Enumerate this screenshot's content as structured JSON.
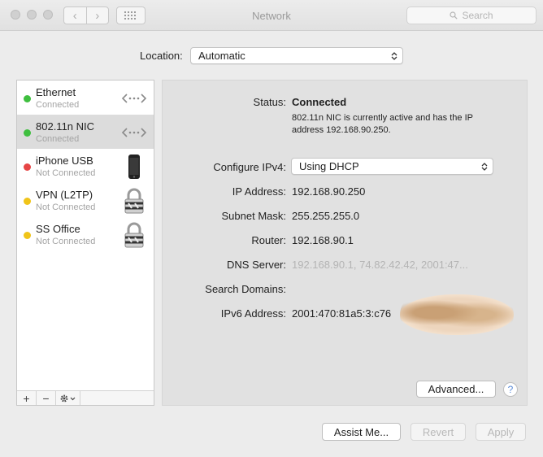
{
  "window": {
    "title": "Network"
  },
  "search": {
    "placeholder": "Search"
  },
  "location": {
    "label": "Location:",
    "value": "Automatic"
  },
  "services": [
    {
      "name": "Ethernet",
      "status": "Connected",
      "dot_color": "#3fbf3f",
      "icon": "ethernet-arrows-icon"
    },
    {
      "name": "802.11n NIC",
      "status": "Connected",
      "dot_color": "#3fbf3f",
      "icon": "ethernet-arrows-icon",
      "selected": true
    },
    {
      "name": "iPhone USB",
      "status": "Not Connected",
      "dot_color": "#e64545",
      "icon": "iphone-icon"
    },
    {
      "name": "VPN (L2TP)",
      "status": "Not Connected",
      "dot_color": "#f0c419",
      "icon": "lock-icon"
    },
    {
      "name": "SS Office",
      "status": "Not Connected",
      "dot_color": "#f0c419",
      "icon": "lock-icon"
    }
  ],
  "toolbar": {
    "add": "+",
    "remove": "−"
  },
  "detail": {
    "status_label": "Status:",
    "status_value": "Connected",
    "status_description": "802.11n NIC is currently active and has the IP address 192.168.90.250.",
    "configure_label": "Configure IPv4:",
    "configure_value": "Using DHCP",
    "ip_label": "IP Address:",
    "ip_value": "192.168.90.250",
    "subnet_label": "Subnet Mask:",
    "subnet_value": "255.255.255.0",
    "router_label": "Router:",
    "router_value": "192.168.90.1",
    "dns_label": "DNS Server:",
    "dns_value": "192.168.90.1, 74.82.42.42, 2001:47...",
    "search_domains_label": "Search Domains:",
    "ipv6_label": "IPv6 Address:",
    "ipv6_value": "2001:470:81a5:3:c76",
    "advanced_button": "Advanced...",
    "help_button": "?"
  },
  "footer": {
    "assist_button": "Assist Me...",
    "revert_button": "Revert",
    "apply_button": "Apply"
  }
}
